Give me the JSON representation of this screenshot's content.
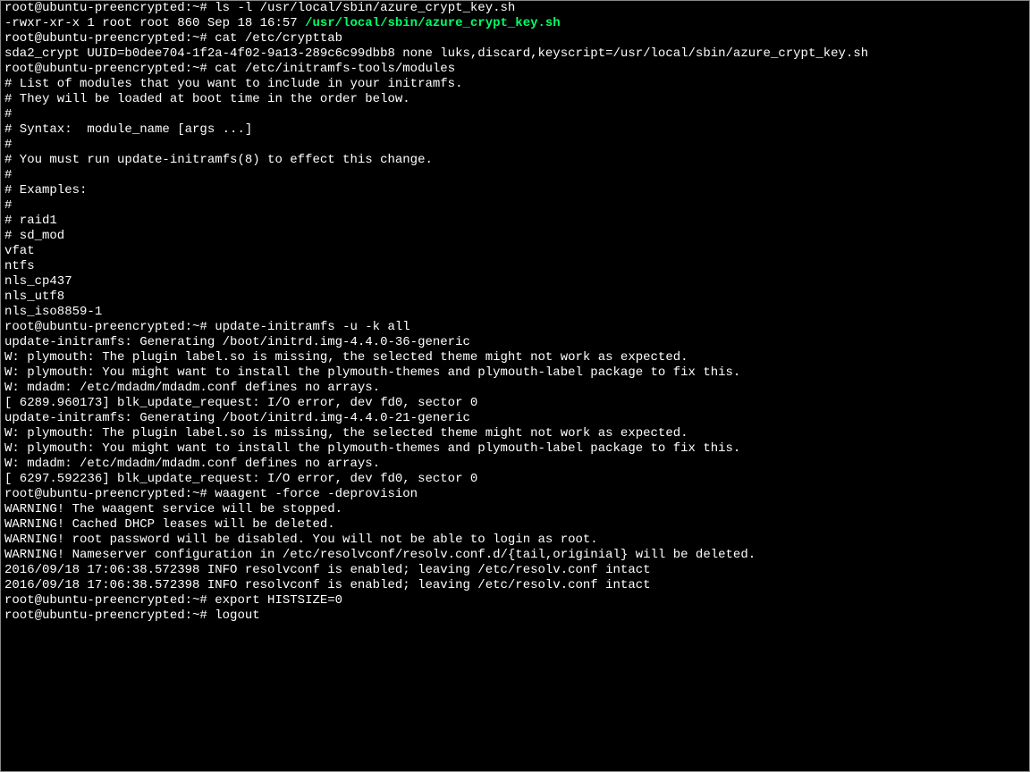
{
  "prompt": "root@ubuntu-preencrypted:~# ",
  "lines": [
    {
      "type": "cmd",
      "text": "ls -l /usr/local/sbin/azure_crypt_key.sh"
    },
    {
      "type": "ls",
      "meta": "-rwxr-xr-x 1 root root 860 Sep 18 16:57 ",
      "path": "/usr/local/sbin/azure_crypt_key.sh"
    },
    {
      "type": "cmd",
      "text": "cat /etc/crypttab"
    },
    {
      "type": "out",
      "text": "sda2_crypt UUID=b0dee704-1f2a-4f02-9a13-289c6c99dbb8 none luks,discard,keyscript=/usr/local/sbin/azure_crypt_key.sh"
    },
    {
      "type": "cmd",
      "text": "cat /etc/initramfs-tools/modules"
    },
    {
      "type": "out",
      "text": "# List of modules that you want to include in your initramfs."
    },
    {
      "type": "out",
      "text": "# They will be loaded at boot time in the order below."
    },
    {
      "type": "out",
      "text": "#"
    },
    {
      "type": "out",
      "text": "# Syntax:  module_name [args ...]"
    },
    {
      "type": "out",
      "text": "#"
    },
    {
      "type": "out",
      "text": "# You must run update-initramfs(8) to effect this change."
    },
    {
      "type": "out",
      "text": "#"
    },
    {
      "type": "out",
      "text": "# Examples:"
    },
    {
      "type": "out",
      "text": "#"
    },
    {
      "type": "out",
      "text": "# raid1"
    },
    {
      "type": "out",
      "text": "# sd_mod"
    },
    {
      "type": "out",
      "text": "vfat"
    },
    {
      "type": "out",
      "text": "ntfs"
    },
    {
      "type": "out",
      "text": "nls_cp437"
    },
    {
      "type": "out",
      "text": "nls_utf8"
    },
    {
      "type": "out",
      "text": "nls_iso8859-1"
    },
    {
      "type": "cmd",
      "text": "update-initramfs -u -k all"
    },
    {
      "type": "out",
      "text": "update-initramfs: Generating /boot/initrd.img-4.4.0-36-generic"
    },
    {
      "type": "out",
      "text": "W: plymouth: The plugin label.so is missing, the selected theme might not work as expected."
    },
    {
      "type": "out",
      "text": "W: plymouth: You might want to install the plymouth-themes and plymouth-label package to fix this."
    },
    {
      "type": "out",
      "text": "W: mdadm: /etc/mdadm/mdadm.conf defines no arrays."
    },
    {
      "type": "out",
      "text": "[ 6289.960173] blk_update_request: I/O error, dev fd0, sector 0"
    },
    {
      "type": "out",
      "text": "update-initramfs: Generating /boot/initrd.img-4.4.0-21-generic"
    },
    {
      "type": "out",
      "text": "W: plymouth: The plugin label.so is missing, the selected theme might not work as expected."
    },
    {
      "type": "out",
      "text": "W: plymouth: You might want to install the plymouth-themes and plymouth-label package to fix this."
    },
    {
      "type": "out",
      "text": "W: mdadm: /etc/mdadm/mdadm.conf defines no arrays."
    },
    {
      "type": "out",
      "text": "[ 6297.592236] blk_update_request: I/O error, dev fd0, sector 0"
    },
    {
      "type": "cmd",
      "text": "waagent -force -deprovision"
    },
    {
      "type": "out",
      "text": "WARNING! The waagent service will be stopped."
    },
    {
      "type": "out",
      "text": "WARNING! Cached DHCP leases will be deleted."
    },
    {
      "type": "out",
      "text": "WARNING! root password will be disabled. You will not be able to login as root."
    },
    {
      "type": "out",
      "text": "WARNING! Nameserver configuration in /etc/resolvconf/resolv.conf.d/{tail,originial} will be deleted."
    },
    {
      "type": "out",
      "text": "2016/09/18 17:06:38.572398 INFO resolvconf is enabled; leaving /etc/resolv.conf intact"
    },
    {
      "type": "out",
      "text": "2016/09/18 17:06:38.572398 INFO resolvconf is enabled; leaving /etc/resolv.conf intact"
    },
    {
      "type": "cmd",
      "text": "export HISTSIZE=0"
    },
    {
      "type": "cmd",
      "text": "logout"
    }
  ]
}
